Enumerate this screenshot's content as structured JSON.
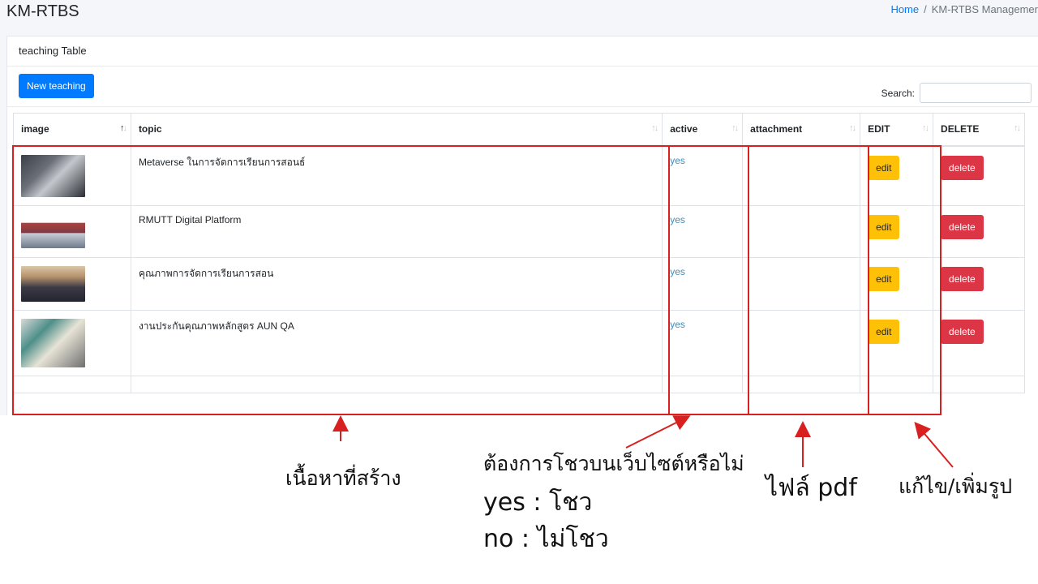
{
  "app": {
    "title": "KM-RTBS",
    "breadcrumb_home": "Home",
    "breadcrumb_sep": "/",
    "breadcrumb_current": "KM-RTBS Managemer"
  },
  "card": {
    "header": "teaching Table",
    "new_button": "New teaching",
    "search_label": "Search:",
    "search_value": ""
  },
  "table": {
    "headers": [
      "image",
      "topic",
      "active",
      "attachment",
      "EDIT",
      "DELETE"
    ],
    "edit_label": "edit",
    "delete_label": "delete",
    "rows": [
      {
        "topic": "Metaverse ในการจัดการเรียนการสอนธ์",
        "active": "yes",
        "attachment": ""
      },
      {
        "topic": "RMUTT Digital Platform",
        "active": "yes",
        "attachment": ""
      },
      {
        "topic": "คุณภาพการจัดการเรียนการสอน",
        "active": "yes",
        "attachment": ""
      },
      {
        "topic": "งานประกันคุณภาพหลักสูตร AUN QA",
        "active": "yes",
        "attachment": ""
      }
    ]
  },
  "annotations": {
    "content": "เนื้อหาที่สร้าง",
    "show_question": "ต้องการโชวบนเว็บไซต์หรือไม่",
    "yes_line": "yes : โชว",
    "no_line": "no : ไม่โชว",
    "pdf_file": "ไฟล์ pdf",
    "edit_image": "แก้ไข/เพิ่มรูป",
    "annotation_color": "#d92020"
  }
}
